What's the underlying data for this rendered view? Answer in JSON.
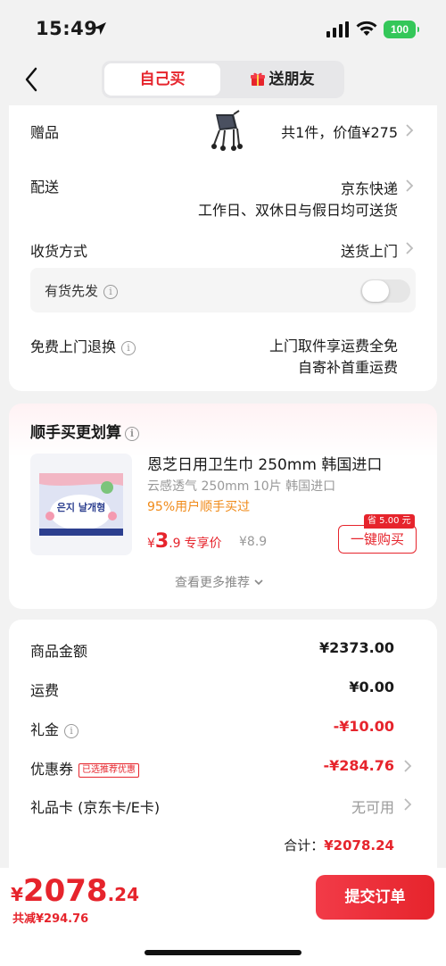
{
  "status_bar": {
    "time": "15:49",
    "battery": "100"
  },
  "nav": {
    "tabs": [
      {
        "label": "自己买"
      },
      {
        "label": "送朋友"
      }
    ]
  },
  "order_info": {
    "gift_label": "赠品",
    "gift_value": "共1件，价值¥275",
    "delivery_label": "配送",
    "delivery_value": "京东快递",
    "delivery_note": "工作日、双休日与假日均可送货",
    "receive_label": "收货方式",
    "receive_value": "送货上门",
    "stock_first_label": "有货先发",
    "stock_first_on": false,
    "return_label": "免费上门退换",
    "return_line1": "上门取件享运费全免",
    "return_line2": "自寄补首重运费"
  },
  "recommend": {
    "title": "顺手买更划算",
    "product": {
      "name": "恩芝日用卫生巾 250mm 韩国进口",
      "subtitle": "云感透气 250mm 10片 韩国进口",
      "tag": "95%用户顺手买过",
      "price_symbol": "¥",
      "price_int": "3",
      "price_dec": ".9",
      "price_label": "专享价",
      "original_price": "¥8.9",
      "save_badge": "省 5.00 元",
      "buy_button": "一键购买",
      "package_text": "은지 날개형"
    },
    "more": "查看更多推荐"
  },
  "summary": {
    "goods_label": "商品金额",
    "goods_value": "¥2373.00",
    "shipping_label": "运费",
    "shipping_value": "¥0.00",
    "cash_gift_label": "礼金",
    "cash_gift_value": "-¥10.00",
    "coupon_label": "优惠券",
    "coupon_tag": "已选推荐优惠",
    "coupon_value": "-¥284.76",
    "giftcard_label": "礼品卡 (京东卡/E卡)",
    "giftcard_value": "无可用",
    "total_label": "合计：",
    "total_value": "¥2078.24"
  },
  "bottom": {
    "price_symbol": "¥",
    "price_int": "2078",
    "price_dec": ".24",
    "saved": "共减¥294.76",
    "submit": "提交订单"
  },
  "colors": {
    "accent": "#e6242c",
    "orange": "#f08a18",
    "background": "#f2f2f2"
  }
}
